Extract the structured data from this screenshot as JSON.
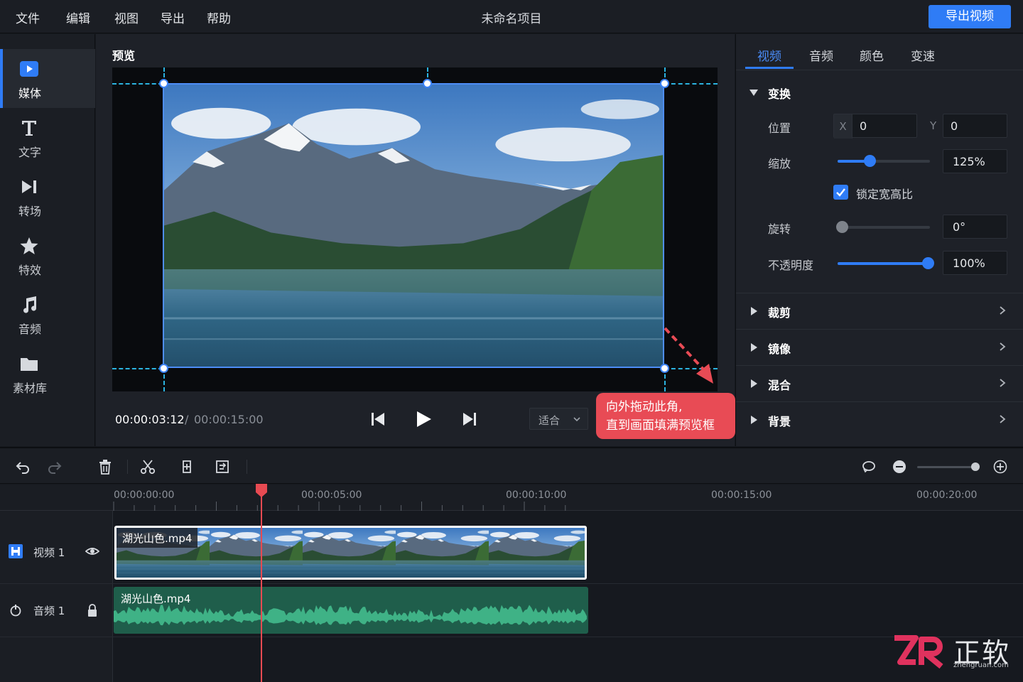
{
  "menu": {
    "items": [
      "文件",
      "编辑",
      "视图",
      "导出",
      "帮助"
    ]
  },
  "project_title": "未命名项目",
  "export_label": "导出视频",
  "sidebar": {
    "items": [
      {
        "label": "媒体",
        "icon": "play-square-icon",
        "active": true
      },
      {
        "label": "文字",
        "icon": "text-t-icon"
      },
      {
        "label": "转场",
        "icon": "transition-icon"
      },
      {
        "label": "特效",
        "icon": "star-icon"
      },
      {
        "label": "音频",
        "icon": "music-note-icon"
      },
      {
        "label": "素材库",
        "icon": "folder-icon"
      }
    ]
  },
  "preview": {
    "title": "预览",
    "time_current": "00:00:03:12",
    "time_separator": "/",
    "time_total": "00:00:15:00",
    "fit_label": "适合",
    "tooltip_line1": "向外拖动此角,",
    "tooltip_line2": "直到画面填满预览框"
  },
  "properties": {
    "tabs": [
      "视频",
      "音频",
      "颜色",
      "变速"
    ],
    "active_tab": "视频",
    "transform": {
      "title": "变换",
      "position_label": "位置",
      "x_prefix": "X",
      "x_value": "0",
      "y_prefix": "Y",
      "y_value": "0",
      "scale_label": "缩放",
      "scale_value": "125%",
      "scale_fraction": 0.35,
      "lock_label": "锁定宽高比",
      "lock_checked": true,
      "rotate_label": "旋转",
      "rotate_value": "0°",
      "rotate_fraction": 0.0,
      "opacity_label": "不透明度",
      "opacity_value": "100%",
      "opacity_fraction": 1.0
    },
    "sections": [
      "裁剪",
      "镜像",
      "混合",
      "背景"
    ]
  },
  "timeline": {
    "ruler": [
      "00:00:00:00",
      "00:00:05:00",
      "00:00:10:00",
      "00:00:15:00",
      "00:00:20:00"
    ],
    "video_track": {
      "name": "视频 1",
      "clip": "湖光山色.mp4"
    },
    "audio_track": {
      "name": "音频 1",
      "clip": "湖光山色.mp4"
    }
  },
  "watermark": {
    "text": "正软",
    "sub": "zhengruan.com"
  },
  "colors": {
    "accent": "#2f7cf6",
    "tooltip": "#e84b55",
    "playhead": "#e74a52",
    "audio_clip": "#1f5e4b"
  }
}
